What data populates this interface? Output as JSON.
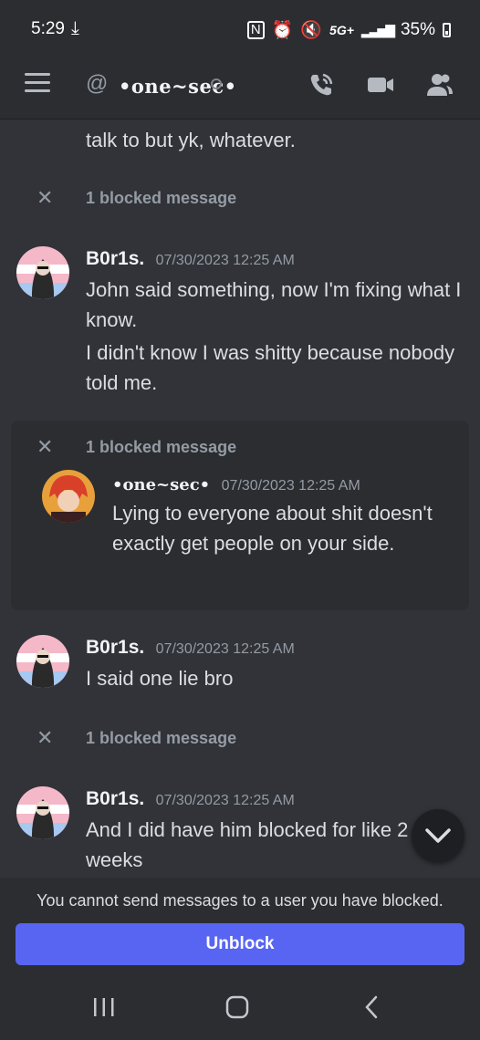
{
  "status_bar": {
    "time": "5:29",
    "network": "5G+",
    "battery": "35%"
  },
  "header": {
    "at_symbol": "@",
    "channel_name": "•one~sec•"
  },
  "messages": {
    "partial_text": "talk to but yk, whatever.",
    "blocked_1": "1 blocked message",
    "m1": {
      "username": "B0r1s.",
      "timestamp": "07/30/2023 12:25 AM",
      "line1": "John said something, now I'm fixing what I know.",
      "line2": "I didn't know I was shitty because nobody told me."
    },
    "blocked_2": "1 blocked message",
    "m2": {
      "username": "•one~sec•",
      "timestamp": "07/30/2023 12:25 AM",
      "line1": "Lying to everyone about shit doesn't exactly get people on your side."
    },
    "m3": {
      "username": "B0r1s.",
      "timestamp": "07/30/2023 12:25 AM",
      "line1": "I said one lie bro"
    },
    "blocked_3": "1 blocked message",
    "m4": {
      "username": "B0r1s.",
      "timestamp": "07/30/2023 12:25 AM",
      "line1": "And I did have him blocked for like 2 weeks"
    }
  },
  "footer": {
    "notice": "You cannot send messages to a user you have blocked.",
    "unblock_label": "Unblock"
  },
  "colors": {
    "background": "#313338",
    "header": "#2b2d31",
    "accent": "#5865f2",
    "muted": "#949ba4"
  }
}
